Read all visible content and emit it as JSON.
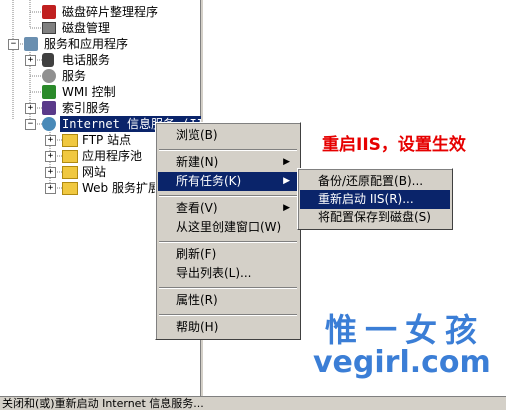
{
  "tree": {
    "items": [
      {
        "label": "磁盘碎片整理程序"
      },
      {
        "label": "磁盘管理"
      },
      {
        "label": "服务和应用程序"
      },
      {
        "label": "电话服务"
      },
      {
        "label": "服务"
      },
      {
        "label": "WMI 控制"
      },
      {
        "label": "索引服务"
      },
      {
        "label": "Internet 信息服务 (IIS)"
      },
      {
        "label": "FTP 站点"
      },
      {
        "label": "应用程序池"
      },
      {
        "label": "网站"
      },
      {
        "label": "Web 服务扩展"
      }
    ]
  },
  "context_menu": {
    "items": [
      {
        "label": "浏览(B)"
      },
      {
        "label": "新建(N)"
      },
      {
        "label": "所有任务(K)"
      },
      {
        "label": "查看(V)"
      },
      {
        "label": "从这里创建窗口(W)"
      },
      {
        "label": "刷新(F)"
      },
      {
        "label": "导出列表(L)..."
      },
      {
        "label": "属性(R)"
      },
      {
        "label": "帮助(H)"
      }
    ]
  },
  "submenu": {
    "items": [
      {
        "label": "备份/还原配置(B)..."
      },
      {
        "label": "重新启动 IIS(R)..."
      },
      {
        "label": "将配置保存到磁盘(S)"
      }
    ]
  },
  "annotation": "重启IIS，设置生效",
  "watermark": {
    "cn": "惟一女孩",
    "url": "vegirl.com"
  },
  "status_bar": "关闭和(或)重新启动 Internet 信息服务...",
  "colors": {
    "selection": "#0a246a",
    "annotation": "#e60000",
    "watermark": "#3b7ed6",
    "face": "#d4d0c8"
  }
}
